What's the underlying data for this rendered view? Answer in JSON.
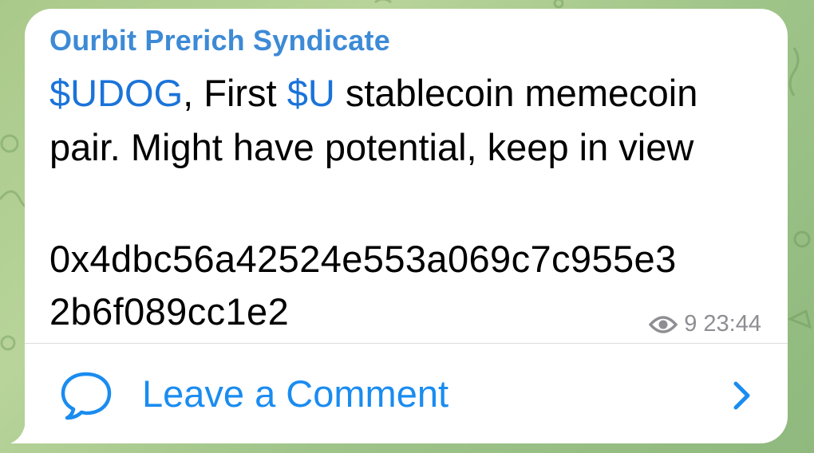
{
  "post": {
    "sender": "Ourbit Prerich Syndicate",
    "line1": {
      "tag1": "$UDOG",
      "text1": ", First ",
      "tag2": "$U",
      "text2": " stablecoin memecoin"
    },
    "line2": "pair. Might have potential, keep in view",
    "contract_line1": "0x4dbc56a42524e553a069c7c955e3",
    "contract_line2": "2b6f089cc1e2",
    "views": "9",
    "time": "23:44"
  },
  "comments": {
    "label": "Leave a Comment"
  },
  "icons": {
    "views": "eye-icon",
    "comment": "speech-bubble-icon",
    "chevron": "chevron-right-icon"
  },
  "colors": {
    "sender": "#3d8ad6",
    "cashtag": "#1a73d9",
    "comment_accent": "#1a8cf0",
    "meta": "#8e8e93"
  }
}
